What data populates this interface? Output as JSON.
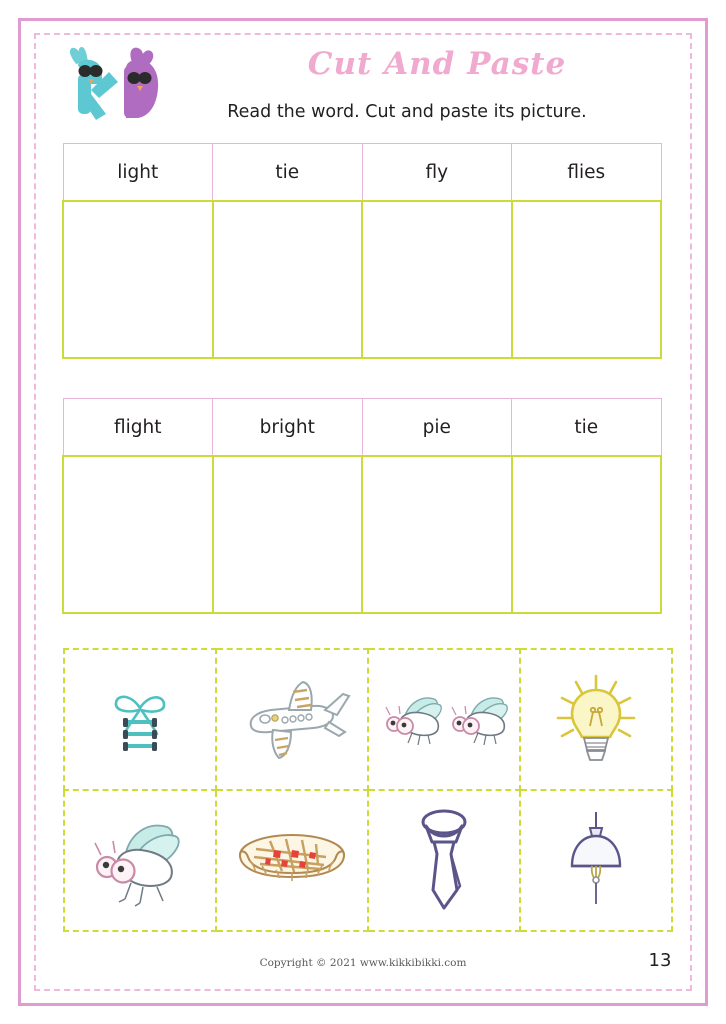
{
  "worksheet": {
    "title": "Cut And Paste",
    "subtitle": "Read the word. Cut and paste its picture.",
    "logo_alt": "kikkibikki-bird-letters-logo",
    "page_number": "13",
    "copyright": "Copyright © 2021 www.kikkibikki.com"
  },
  "colors": {
    "frame_pink": "#e09cd2",
    "dashed_pink": "#eeb9da",
    "title_pink": "#f0a9cf",
    "word_border_pink": "#e8b6d8",
    "answer_border_green": "#ccdb3c",
    "cut_dash_green": "#cddc39",
    "text_dark": "#231f20",
    "teal": "#5ec8c8",
    "purple": "#5b5589",
    "yellow": "#e8d83c",
    "red": "#e8413c",
    "tan": "#c8a878"
  },
  "tables": [
    {
      "id": "table-1",
      "words": [
        "light",
        "tie",
        "fly",
        "flies"
      ],
      "answer_cells": [
        "",
        "",
        "",
        ""
      ]
    },
    {
      "id": "table-2",
      "words": [
        "flight",
        "bright",
        "pie",
        "tie"
      ],
      "answer_cells": [
        "",
        "",
        "",
        ""
      ]
    }
  ],
  "cut_grid": {
    "rows": [
      [
        {
          "icon": "shoelace-bow-icon",
          "label": "tie"
        },
        {
          "icon": "airplane-icon",
          "label": "flight"
        },
        {
          "icon": "two-flies-icon",
          "label": "flies"
        },
        {
          "icon": "light-bulb-icon",
          "label": "bright"
        }
      ],
      [
        {
          "icon": "fly-icon",
          "label": "fly"
        },
        {
          "icon": "pie-icon",
          "label": "pie"
        },
        {
          "icon": "necktie-icon",
          "label": "tie"
        },
        {
          "icon": "hanging-lamp-icon",
          "label": "light"
        }
      ]
    ]
  }
}
